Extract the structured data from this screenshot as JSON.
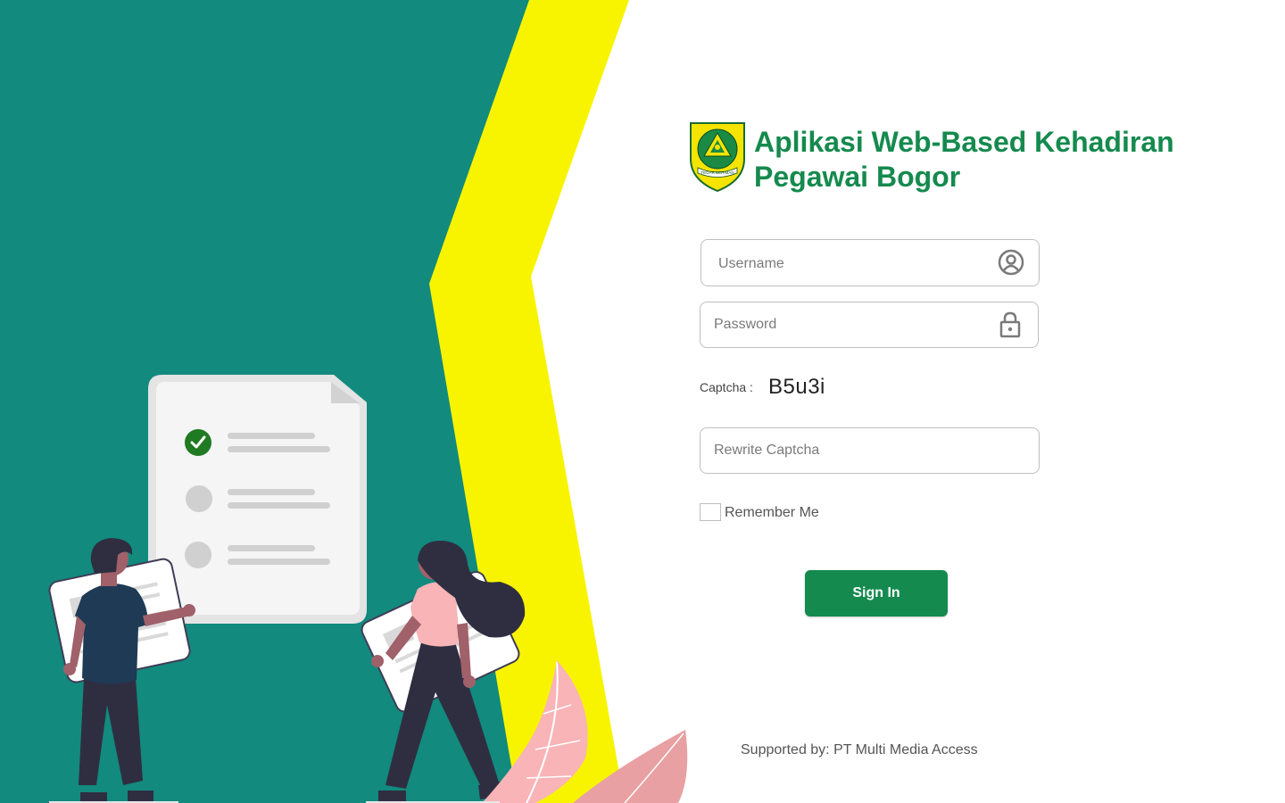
{
  "header": {
    "title_line1": "Aplikasi Web-Based Kehadiran",
    "title_line2": "Pegawai Bogor",
    "logo_icon": "bogor-regency-emblem",
    "logo_text": "TEGAR BERIMAN"
  },
  "form": {
    "username_placeholder": "Username",
    "username_icon": "user-circle-icon",
    "password_placeholder": "Password",
    "password_icon": "lock-icon",
    "captcha_label": "Captcha :",
    "captcha_value": "B5u3i",
    "rewrite_captcha_placeholder": "Rewrite Captcha",
    "remember_label": "Remember Me",
    "remember_checked": false,
    "signin_label": "Sign In"
  },
  "footer": {
    "supported_by": "Supported by: PT Multi Media Access"
  },
  "colors": {
    "brand_green": "#158a4e",
    "teal": "#128a7e",
    "yellow": "#f8f400",
    "check_green": "#1f7a22",
    "leaf_pink": "#f8b4b7"
  }
}
